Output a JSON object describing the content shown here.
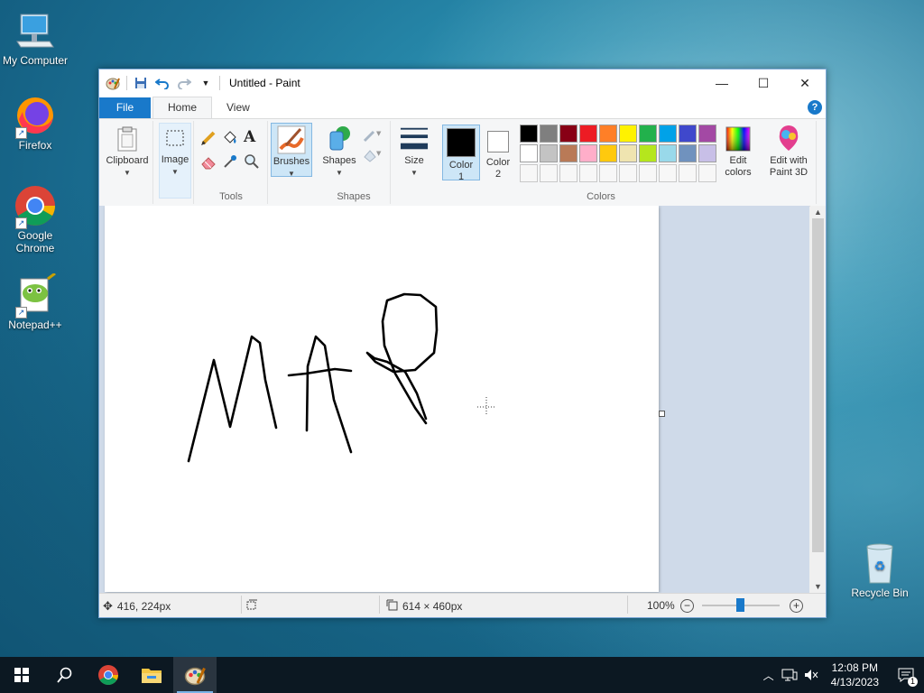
{
  "desktop": {
    "icons": [
      {
        "label": "My Computer"
      },
      {
        "label": "Firefox"
      },
      {
        "label": "Google Chrome"
      },
      {
        "label": "Notepad++"
      },
      {
        "label": "Recycle Bin"
      }
    ]
  },
  "window": {
    "title": "Untitled - Paint",
    "tabs": {
      "file": "File",
      "home": "Home",
      "view": "View"
    },
    "help": "?"
  },
  "ribbon": {
    "clipboard": "Clipboard",
    "image": "Image",
    "tools_group": "Tools",
    "brushes": "Brushes",
    "shapes_btn": "Shapes",
    "shapes_group": "Shapes",
    "size": "Size",
    "color1_line1": "Color",
    "color1_line2": "1",
    "color2_line1": "Color",
    "color2_line2": "2",
    "colors_group": "Colors",
    "edit_colors_line1": "Edit",
    "edit_colors_line2": "colors",
    "paint3d_line1": "Edit with",
    "paint3d_line2": "Paint 3D",
    "text_tool": "A"
  },
  "palette": {
    "row1": [
      "#000000",
      "#7f7f7f",
      "#880015",
      "#ed1c24",
      "#ff7f27",
      "#fff200",
      "#22b14c",
      "#00a2e8",
      "#3f48cc",
      "#a349a4"
    ],
    "row2": [
      "#ffffff",
      "#c3c3c3",
      "#b97a57",
      "#ffaec9",
      "#ffc90e",
      "#efe4b0",
      "#b5e61d",
      "#99d9ea",
      "#7092be",
      "#c8bfe7"
    ],
    "color1": "#000000",
    "color2": "#ffffff"
  },
  "status": {
    "cursor_pos": "416, 224px",
    "canvas_size": "614 × 460px",
    "zoom": "100%"
  },
  "taskbar": {
    "time": "12:08 PM",
    "date": "4/13/2023",
    "notifications": "1"
  }
}
